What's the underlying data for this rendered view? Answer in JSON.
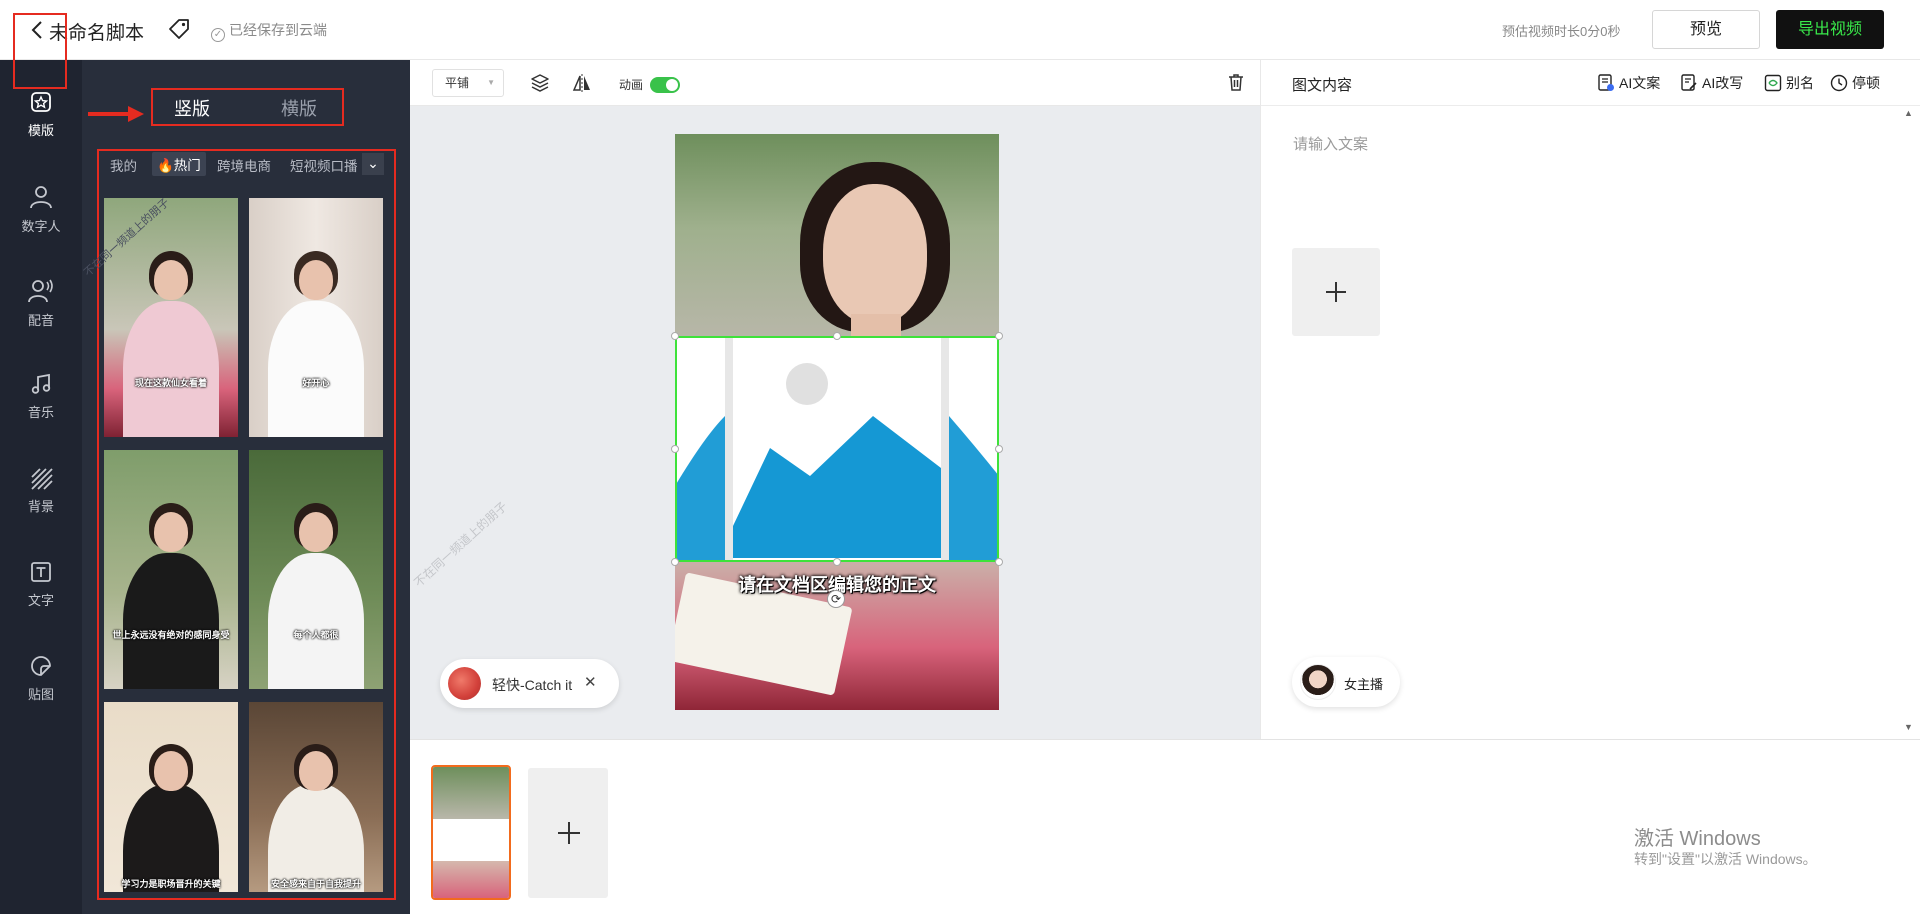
{
  "header": {
    "title": "未命名脚本",
    "saved_status": "已经保存到云端",
    "duration": "预估视频时长0分0秒",
    "preview_label": "预览",
    "export_label": "导出视频"
  },
  "colors": {
    "accent_green": "#39e84a",
    "highlight_red": "#e52b20",
    "nav_bg": "#1f2430",
    "panel_bg": "#282e3b",
    "selection_green": "#3ee23a",
    "scene_orange": "#f26b1d"
  },
  "left_nav": {
    "items": [
      {
        "label": "模版",
        "icon": "template-icon"
      },
      {
        "label": "数字人",
        "icon": "person-icon"
      },
      {
        "label": "配音",
        "icon": "voice-icon"
      },
      {
        "label": "音乐",
        "icon": "music-note-icon"
      },
      {
        "label": "背景",
        "icon": "background-icon"
      },
      {
        "label": "文字",
        "icon": "text-icon"
      },
      {
        "label": "贴图",
        "icon": "sticker-icon"
      }
    ]
  },
  "template_panel": {
    "orientation_tabs": [
      "竖版",
      "横版"
    ],
    "categories": [
      "我的",
      "🔥热门",
      "跨境电商",
      "短视频口播"
    ],
    "thumbnails": [
      {
        "caption": "现在这款仙女看着"
      },
      {
        "caption": "好开心"
      },
      {
        "caption": "世上永远没有绝对的感同身受"
      },
      {
        "caption": "每个人都很"
      },
      {
        "caption": "学习力是职场晋升的关键"
      },
      {
        "caption": "安全感来自于自我提升"
      }
    ],
    "watermark": "不在同一频道上的朋子"
  },
  "canvas": {
    "toolbar": {
      "tile_mode": "平铺",
      "animation_label": "动画",
      "animation_on": true
    },
    "caption": "请在文档区编辑您的正文",
    "watermark": "不在同一频道上的朋子",
    "music": {
      "name": "轻快-Catch it"
    }
  },
  "content_panel": {
    "title": "图文内容",
    "tools": [
      {
        "label": "AI文案",
        "icon": "ai-copy-icon"
      },
      {
        "label": "AI改写",
        "icon": "ai-rewrite-icon"
      },
      {
        "label": "别名",
        "icon": "alias-icon"
      },
      {
        "label": "停顿",
        "icon": "pause-clock-icon"
      }
    ],
    "placeholder": "请输入文案",
    "anchor_name": "女主播"
  },
  "windows_activation": {
    "title": "激活 Windows",
    "subtitle": "转到\"设置\"以激活 Windows。"
  }
}
